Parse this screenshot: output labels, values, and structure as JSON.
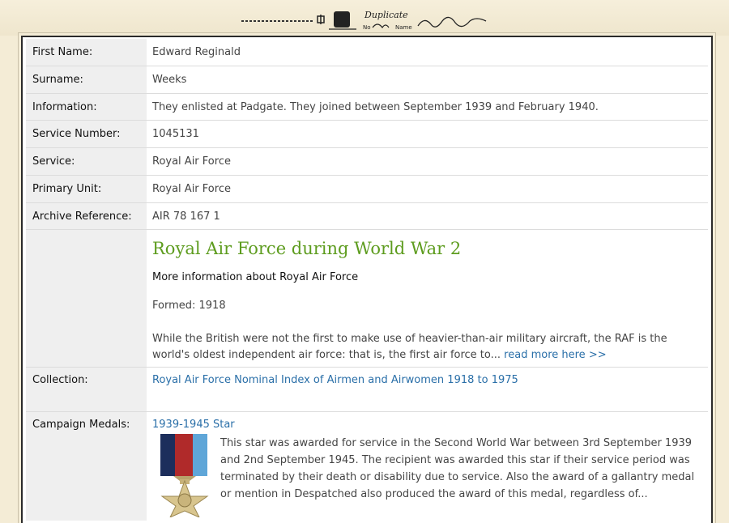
{
  "record": {
    "fields": [
      {
        "label": "First Name:",
        "value": "Edward Reginald"
      },
      {
        "label": "Surname:",
        "value": "Weeks"
      },
      {
        "label": "Information:",
        "value": "They enlisted at Padgate. They joined between September 1939 and February 1940."
      },
      {
        "label": "Service Number:",
        "value": "1045131"
      },
      {
        "label": "Service:",
        "value": "Royal Air Force"
      },
      {
        "label": "Primary Unit:",
        "value": "Royal Air Force"
      },
      {
        "label": "Archive Reference:",
        "value": "AIR 78 167 1"
      }
    ],
    "unit_info": {
      "title": "Royal Air Force during World War 2",
      "more_info": "More information about Royal Air Force",
      "formed": "Formed: 1918",
      "description": "While the British were not the first to make use of heavier-than-air military aircraft, the RAF is the world's oldest independent air force: that is, the first air force to...",
      "read_more": "read more here  >>"
    },
    "collection": {
      "label": "Collection:",
      "value": "Royal Air Force Nominal Index of Airmen and Airwomen 1918 to 1975"
    },
    "medals": {
      "label": "Campaign Medals:",
      "title": "1939-1945 Star",
      "description": "This star was awarded for service in the Second World War between 3rd September 1939 and 2nd September 1945. The recipient was awarded this star if their service period was terminated by their death or disability due to service. Also the award of a gallantry medal or mention in Despatched also produced the award of this medal, regardless of..."
    }
  },
  "header_stamp": {
    "duplicate_word": "Duplicate",
    "no_label": "No",
    "name_label": "Name"
  },
  "colors": {
    "accent_green": "#5d9c1e",
    "link_blue": "#2a6fa8",
    "label_bg": "#efefef",
    "paper": "#f4ecd6"
  }
}
